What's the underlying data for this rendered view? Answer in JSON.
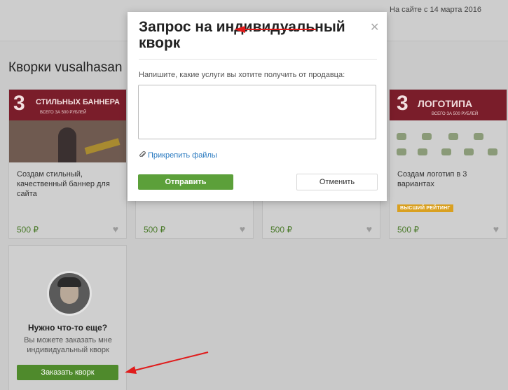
{
  "header": {
    "since": "На сайте с 14 марта 2016"
  },
  "section_title": "Кворки vusalhasan",
  "cards": [
    {
      "title": "Создам стильный, качественный баннер для сайта",
      "price": "500 ₽",
      "image": {
        "big": "3",
        "label": "СТИЛЬНЫХ БАННЕРА",
        "sub": "ВСЕГО ЗА 500 РУБЛЕЙ"
      }
    },
    {
      "price": "500 ₽"
    },
    {
      "price": "500 ₽"
    },
    {
      "title": "Создам логотип в 3 вариантах",
      "price": "500 ₽",
      "badge": "ВЫСШИЙ РЕЙТИНГ",
      "image": {
        "big": "3",
        "label": "ЛОГОТИПА",
        "sub": "ВСЕГО ЗА 500 РУБЛЕЙ"
      }
    }
  ],
  "extra": {
    "heading": "Нужно что-то еще?",
    "text": "Вы можете заказать мне индивидуальный кворк",
    "button": "Заказать кворк"
  },
  "modal": {
    "title": "Запрос на индивидуальный кворк",
    "hint": "Напишите, какие услуги вы хотите получить от продавца:",
    "attach": "Прикрепить файлы",
    "send": "Отправить",
    "cancel": "Отменить"
  },
  "icons": {
    "close": "close-icon",
    "heart": "heart-icon",
    "attach": "paperclip-icon"
  },
  "colors": {
    "green_button": "#5ca03a",
    "arrow": "#e01b1b",
    "link": "#2a7ac0",
    "badge": "#d9a020"
  }
}
